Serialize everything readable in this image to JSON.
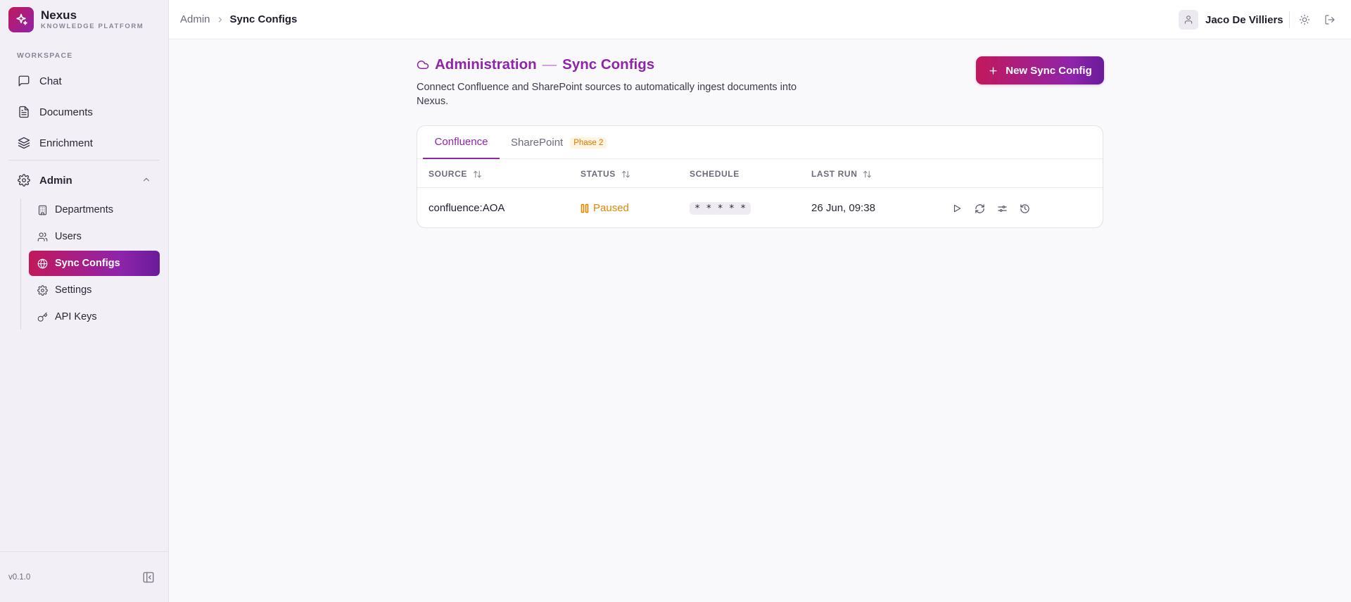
{
  "brand": {
    "name": "Nexus",
    "subtitle": "KNOWLEDGE PLATFORM"
  },
  "sidebar": {
    "section_label": "WORKSPACE",
    "items": [
      {
        "label": "Chat",
        "icon": "chat-icon"
      },
      {
        "label": "Documents",
        "icon": "document-icon"
      },
      {
        "label": "Enrichment",
        "icon": "layers-icon"
      }
    ],
    "admin": {
      "label": "Admin",
      "icon": "gear-icon",
      "expanded": true,
      "children": [
        {
          "label": "Departments",
          "icon": "building-icon"
        },
        {
          "label": "Users",
          "icon": "users-icon"
        },
        {
          "label": "Sync Configs",
          "icon": "globe-icon",
          "active": true
        },
        {
          "label": "Settings",
          "icon": "gear-icon"
        },
        {
          "label": "API Keys",
          "icon": "key-icon"
        }
      ]
    },
    "version": "v0.1.0"
  },
  "topbar": {
    "breadcrumb": {
      "parent": "Admin",
      "current": "Sync Configs"
    },
    "user_name": "Jaco De Villiers"
  },
  "page": {
    "title": "Administration",
    "title_separator": "—",
    "subtitle": "Sync Configs",
    "description": "Connect Confluence and SharePoint sources to automatically ingest documents into Nexus.",
    "new_button_label": "New Sync Config"
  },
  "tabs": {
    "confluence": "Confluence",
    "sharepoint": "SharePoint",
    "sharepoint_badge": "Phase 2"
  },
  "table": {
    "headers": {
      "source": "SOURCE",
      "status": "STATUS",
      "schedule": "SCHEDULE",
      "last_run": "LAST RUN"
    },
    "rows": [
      {
        "source": "confluence:AOA",
        "status": "Paused",
        "schedule": "* * * * *",
        "last_run": "26 Jun, 09:38"
      }
    ]
  },
  "colors": {
    "accent": "#8e24aa",
    "brand_gradient_start": "#c2185b",
    "status_paused": "#e08600",
    "badge_phase": "#d97706"
  }
}
